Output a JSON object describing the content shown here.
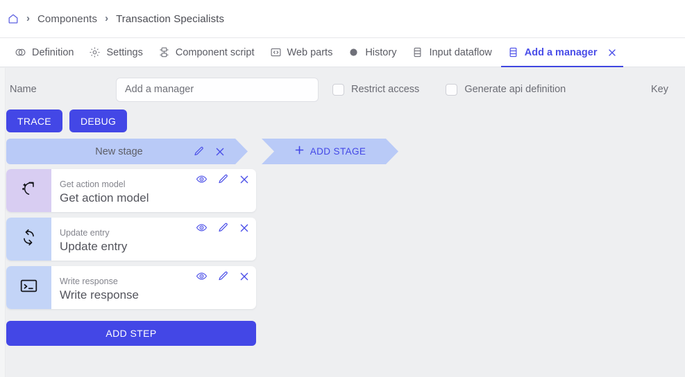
{
  "breadcrumb": {
    "home_icon": "home-icon",
    "separator": "›",
    "items": [
      {
        "label": "Components"
      },
      {
        "label": "Transaction Specialists"
      }
    ]
  },
  "tabs": [
    {
      "label": "Definition",
      "icon": "contrast-icon",
      "active": false,
      "closable": false
    },
    {
      "label": "Settings",
      "icon": "gear-icon",
      "active": false,
      "closable": false
    },
    {
      "label": "Component script",
      "icon": "plugin-icon",
      "active": false,
      "closable": false
    },
    {
      "label": "Web parts",
      "icon": "code-brackets-icon",
      "active": false,
      "closable": false
    },
    {
      "label": "History",
      "icon": "circle-filled-icon",
      "active": false,
      "closable": false
    },
    {
      "label": "Input dataflow",
      "icon": "dataflow-icon",
      "active": false,
      "closable": false
    },
    {
      "label": "Add a manager",
      "icon": "dataflow-icon",
      "active": true,
      "closable": true
    }
  ],
  "form": {
    "name_label": "Name",
    "name_value": "Add a manager",
    "name_placeholder": "Add a manager",
    "restrict_access": {
      "label": "Restrict access",
      "checked": false
    },
    "generate_api": {
      "label": "Generate api definition",
      "checked": false
    },
    "key_label": "Key"
  },
  "actions": {
    "trace_label": "TRACE",
    "debug_label": "DEBUG"
  },
  "stage": {
    "name": "New stage",
    "edit_icon": "pencil-icon",
    "delete_icon": "close-icon",
    "add_stage_label": "ADD STAGE",
    "add_stage_icon": "plus-icon"
  },
  "steps": [
    {
      "subtitle": "Get action model",
      "title": "Get action model",
      "icon": "sparkle-arrow-icon",
      "icon_bg": "#d8cdf2",
      "view_icon": "eye-icon",
      "edit_icon": "pencil-icon",
      "delete_icon": "close-icon"
    },
    {
      "subtitle": "Update entry",
      "title": "Update entry",
      "icon": "sync-arrows-icon",
      "icon_bg": "#c3d4f7",
      "view_icon": "eye-icon",
      "edit_icon": "pencil-icon",
      "delete_icon": "close-icon"
    },
    {
      "subtitle": "Write response",
      "title": "Write response",
      "icon": "terminal-icon",
      "icon_bg": "#c3d4f7",
      "view_icon": "eye-icon",
      "edit_icon": "pencil-icon",
      "delete_icon": "close-icon"
    }
  ],
  "add_step": {
    "label": "ADD STEP"
  },
  "colors": {
    "accent": "#4347e6",
    "accent_light": "#4a4ee8",
    "stage_bg": "#b9caf7",
    "page_bg": "#eeeff1",
    "card_bg": "#ffffff",
    "text_muted": "#6b6c74"
  }
}
